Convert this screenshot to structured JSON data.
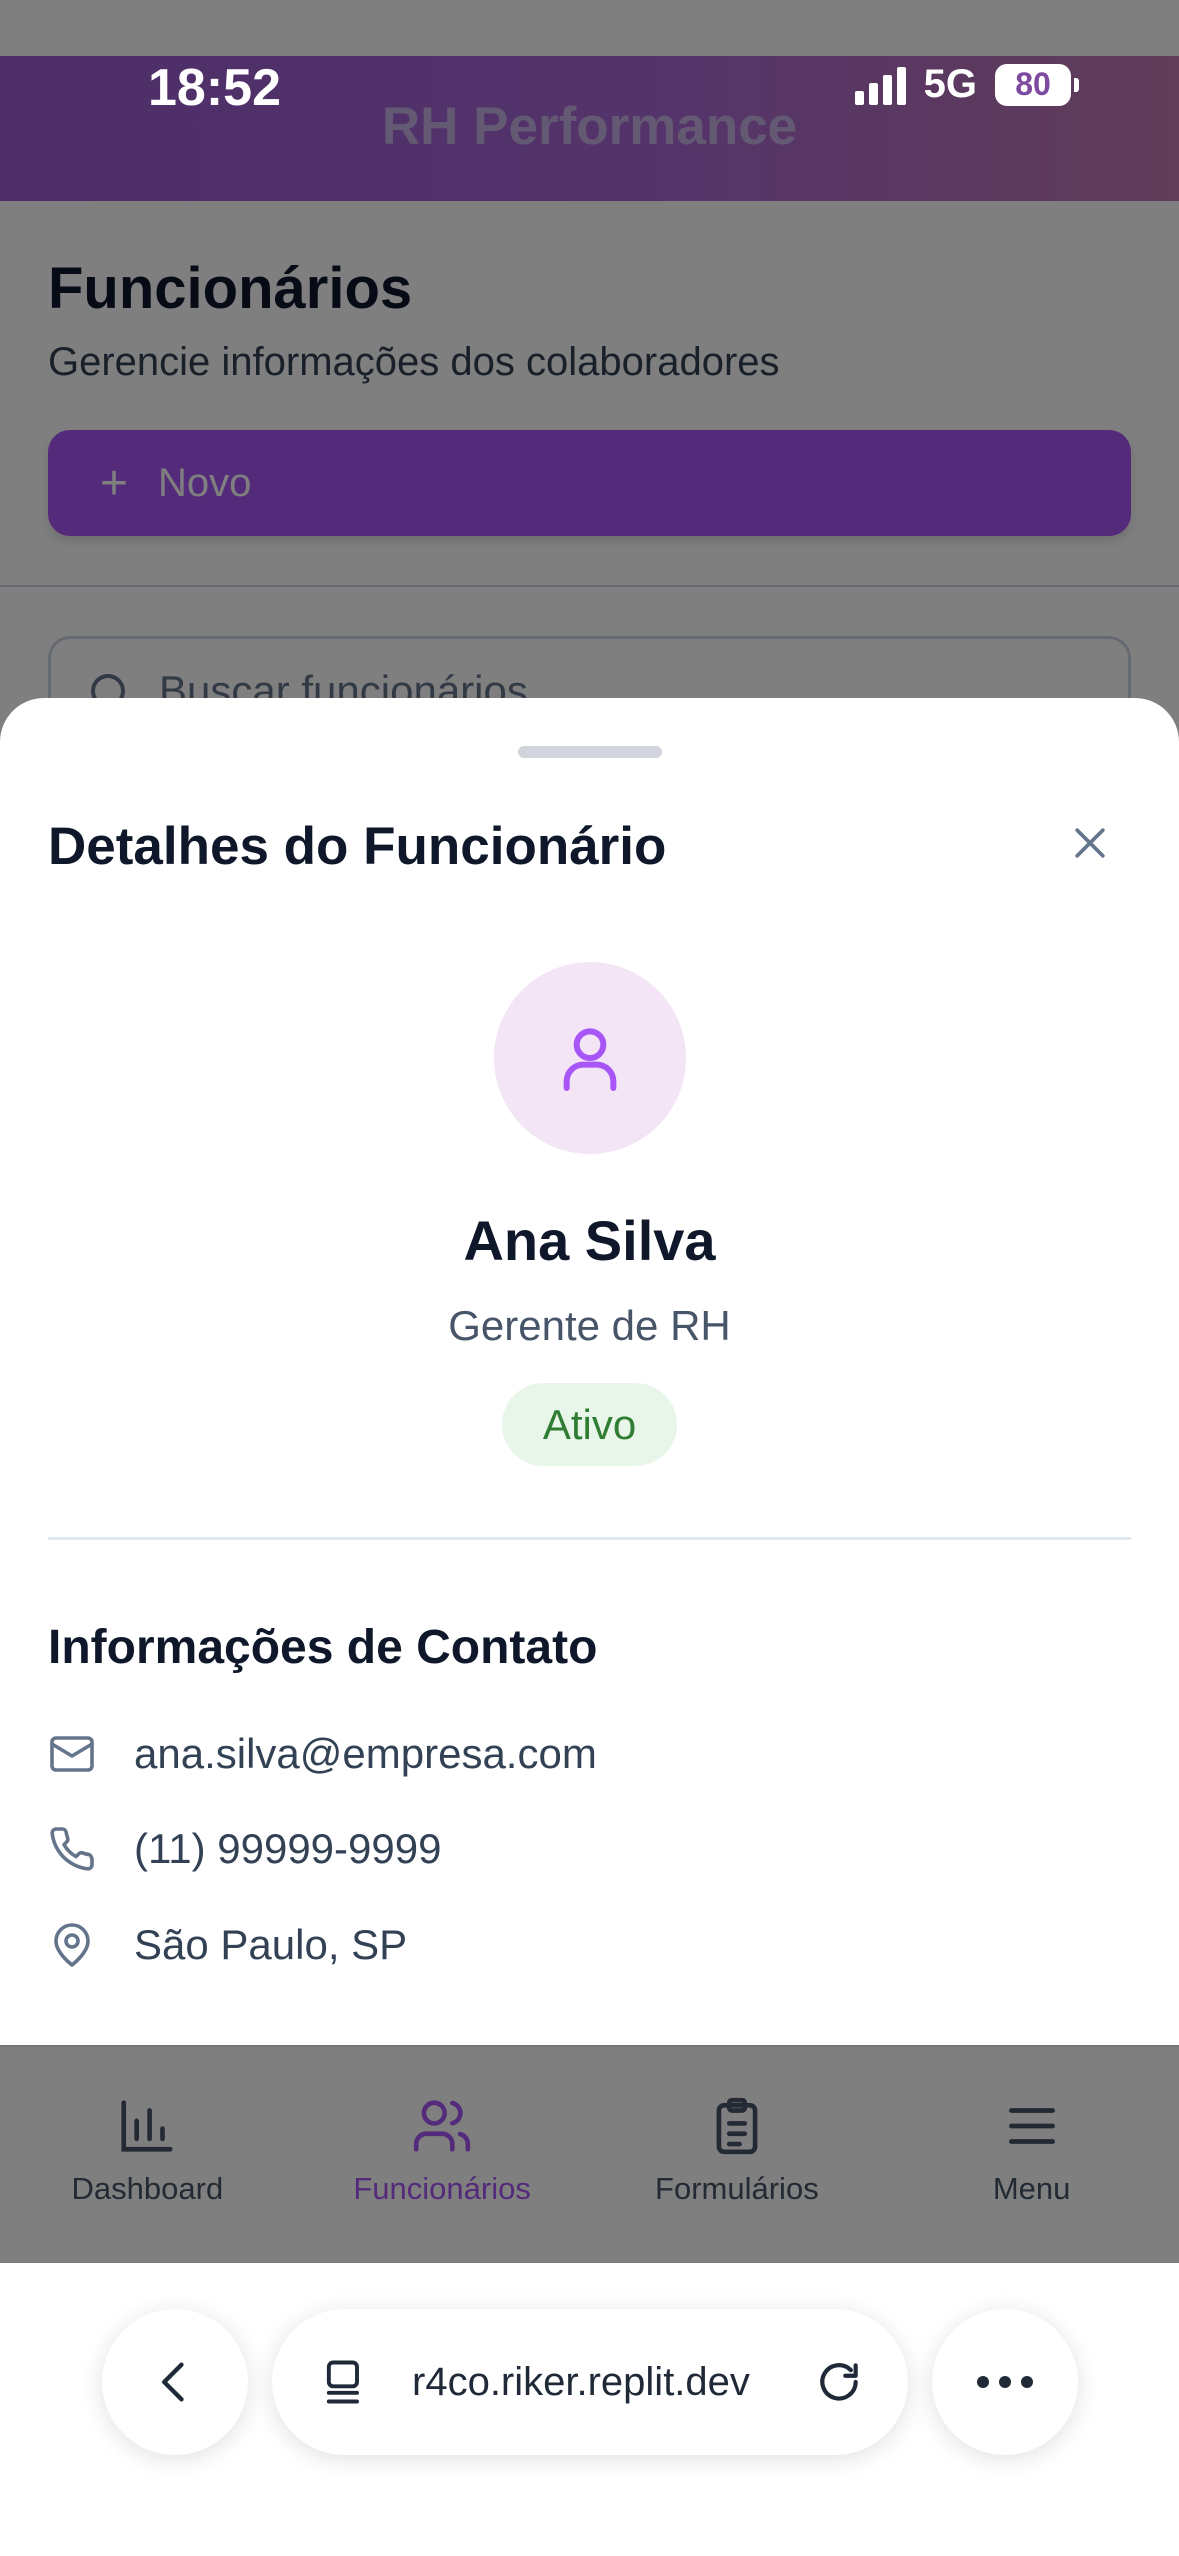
{
  "status_bar": {
    "time": "18:52",
    "network": "5G",
    "battery": "80"
  },
  "app": {
    "header_title": "RH Performance",
    "page_title": "Funcionários",
    "page_subtitle": "Gerencie informações dos colaboradores",
    "new_button": "Novo",
    "search_placeholder": "Buscar funcionários..."
  },
  "sheet": {
    "title": "Detalhes do Funcionário",
    "employee": {
      "name": "Ana Silva",
      "role": "Gerente de RH",
      "status": "Ativo"
    },
    "contact_title": "Informações de Contato",
    "contact": {
      "email": "ana.silva@empresa.com",
      "phone": "(11) 99999-9999",
      "location": "São Paulo, SP"
    }
  },
  "bottom_nav": [
    {
      "label": "Dashboard",
      "icon": "bar-chart-icon"
    },
    {
      "label": "Funcionários",
      "icon": "users-icon",
      "active": true
    },
    {
      "label": "Formulários",
      "icon": "clipboard-icon"
    },
    {
      "label": "Menu",
      "icon": "menu-icon"
    }
  ],
  "browser": {
    "url": "r4co.riker.replit.dev"
  },
  "colors": {
    "accent": "#a855f7",
    "status_bg": "#e8f5e9",
    "status_text": "#2e7d32"
  }
}
